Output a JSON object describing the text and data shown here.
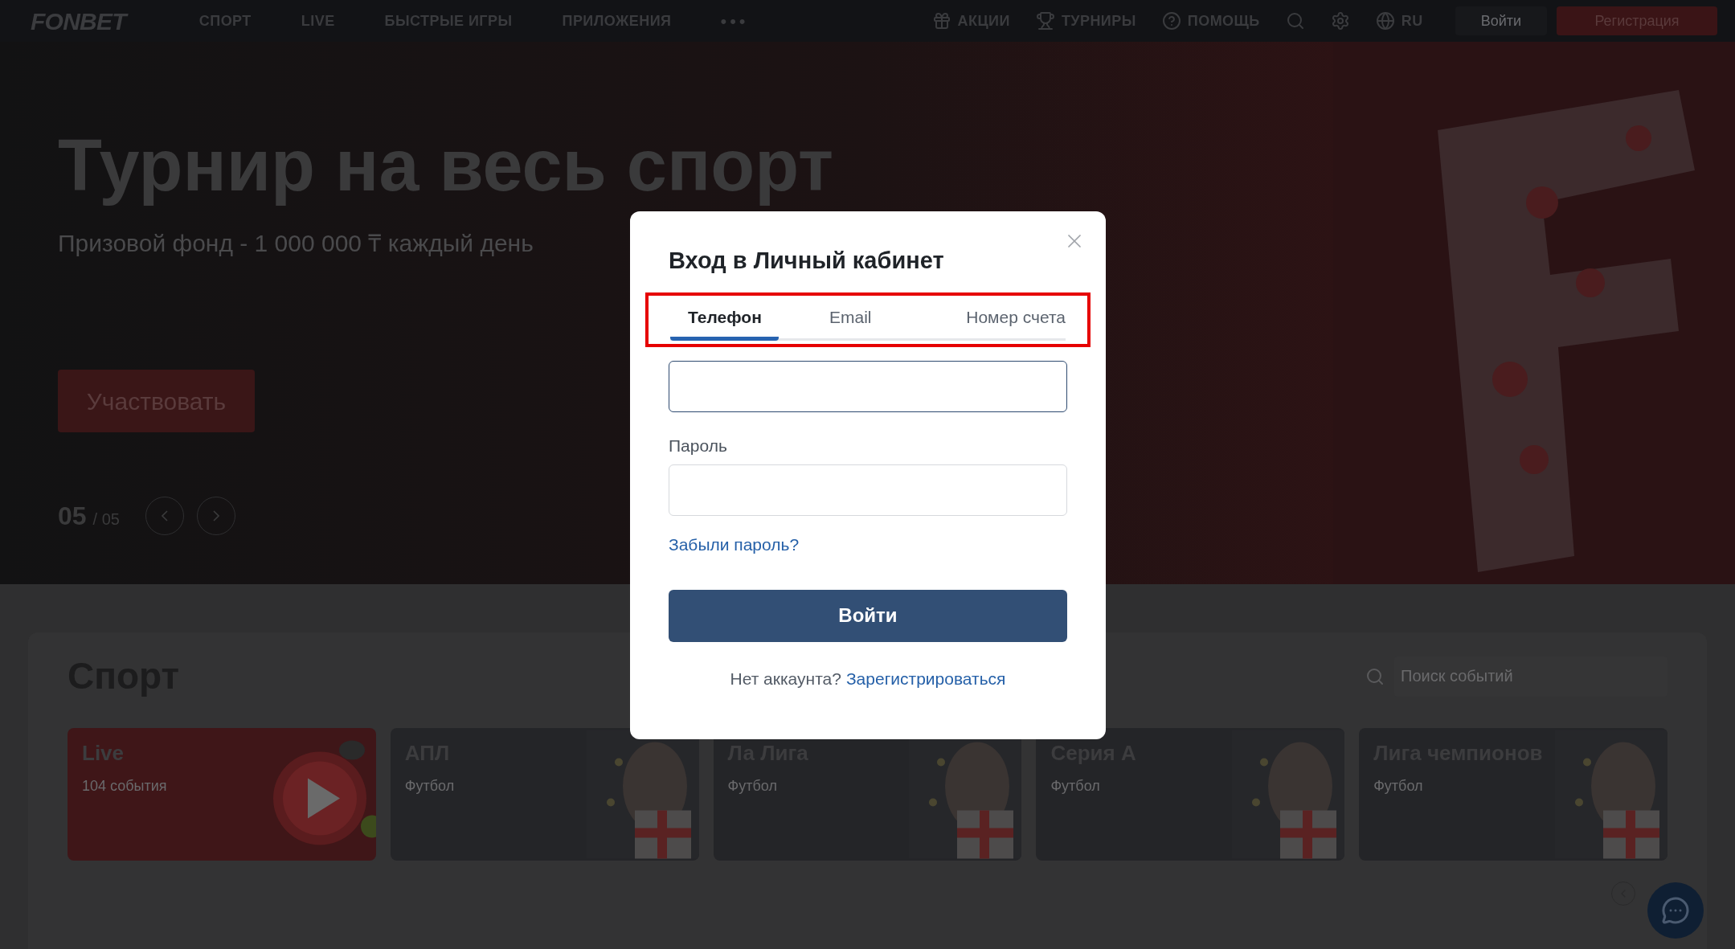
{
  "nav": {
    "logo": "FONBET",
    "items": [
      "СПОРТ",
      "LIVE",
      "БЫСТРЫЕ ИГРЫ",
      "ПРИЛОЖЕНИЯ"
    ],
    "more": "•••",
    "right_items": [
      {
        "kind": "gift",
        "label": "АКЦИИ"
      },
      {
        "kind": "trophy",
        "label": "ТУРНИРЫ"
      },
      {
        "kind": "help",
        "label": "ПОМОЩЬ"
      },
      {
        "kind": "search"
      },
      {
        "kind": "settings"
      },
      {
        "kind": "language",
        "label": "RU"
      }
    ],
    "login": "Войти",
    "register": "Регистрация"
  },
  "hero": {
    "title": "Турнир на весь спорт",
    "subtitle": "Призовой фонд - 1 000 000 ₸ каждый день",
    "button": "Участвовать",
    "slide": "05",
    "slide_total": "/ 05"
  },
  "sport": {
    "title": "Спорт",
    "search": {
      "placeholder": "Поиск событий"
    },
    "cards": [
      {
        "kind": "live",
        "title": "Live",
        "subtitle": "104 события"
      },
      {
        "kind": "league",
        "title": "АПЛ",
        "subtitle": "Футбол"
      },
      {
        "kind": "league",
        "title": "Ла Лига",
        "subtitle": "Футбол"
      },
      {
        "kind": "league",
        "title": "Серия А",
        "subtitle": "Футбол"
      },
      {
        "kind": "league",
        "title": "Лига чемпионов",
        "subtitle": "Футбол"
      }
    ]
  },
  "modal": {
    "title": "Вход в Личный кабинет",
    "tabs_highlighted": true,
    "tabs": [
      {
        "label": "Телефон",
        "selected": true
      },
      {
        "label": "Email",
        "selected": false
      },
      {
        "label": "Номер счета",
        "selected": false
      }
    ],
    "password_label": "Пароль",
    "forgot_link": "Забыли пароль?",
    "submit": "Войти",
    "footer_text": "Нет аккаунта?",
    "footer_link": "Зарегистрироваться"
  }
}
